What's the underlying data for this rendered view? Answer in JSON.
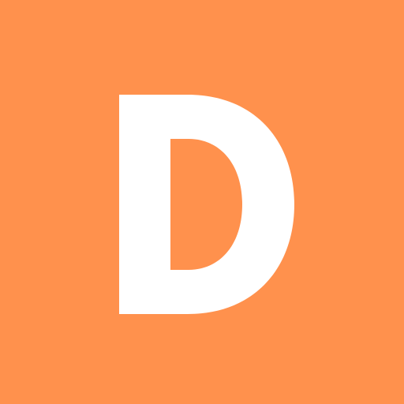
{
  "app_icon": {
    "letter": "D",
    "icon_name": "letter-d-logo-icon",
    "background_color": "#ff914d",
    "glyph_color": "#ffffff"
  }
}
